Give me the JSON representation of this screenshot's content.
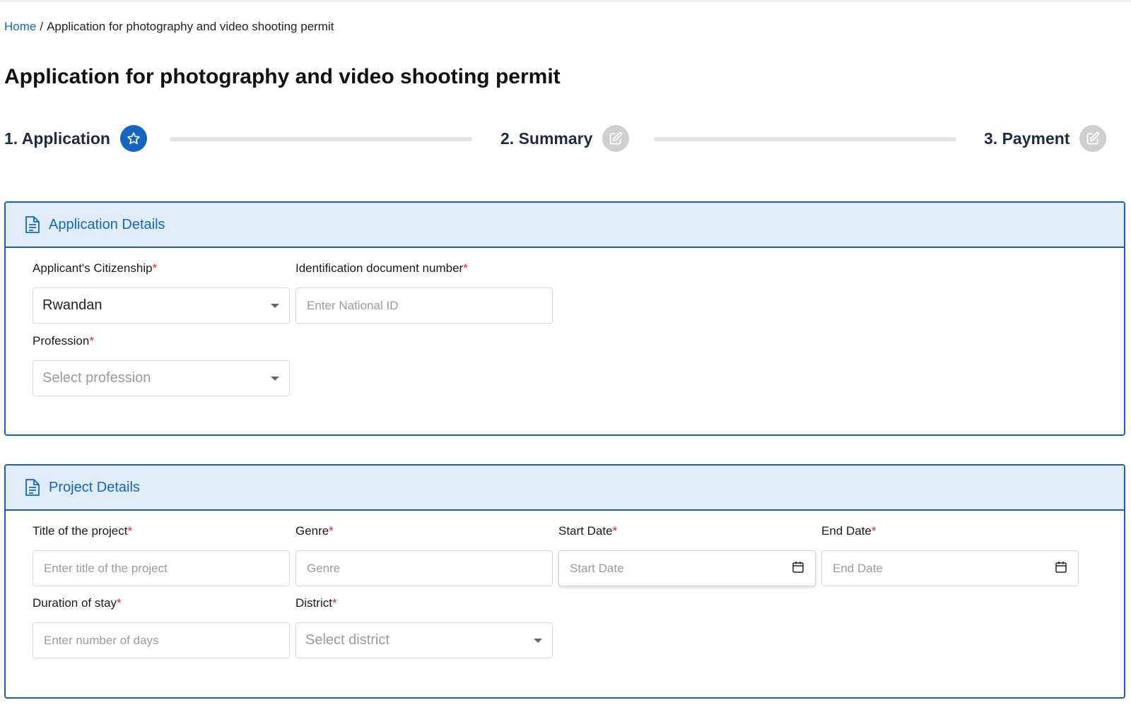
{
  "breadcrumb": {
    "home": "Home",
    "separator": "/",
    "current": "Application for photography and video shooting permit"
  },
  "page": {
    "title": "Application for photography and video shooting permit"
  },
  "steps": [
    {
      "label": "1. Application",
      "icon": "star-icon",
      "state": "active"
    },
    {
      "label": "2. Summary",
      "icon": "edit-icon",
      "state": "inactive"
    },
    {
      "label": "3. Payment",
      "icon": "edit-icon",
      "state": "inactive"
    }
  ],
  "application_details": {
    "title": "Application Details",
    "icon": "document-icon",
    "citizenship": {
      "label": "Applicant's Citizenship",
      "required": "*",
      "value": "Rwandan"
    },
    "id_number": {
      "label": "Identification document number",
      "required": "*",
      "placeholder": "Enter National ID"
    },
    "profession": {
      "label": "Profession",
      "required": "*",
      "placeholder": "Select profession"
    }
  },
  "project_details": {
    "title": "Project Details",
    "icon": "document-icon",
    "project_title": {
      "label": "Title of the project",
      "required": "*",
      "placeholder": "Enter title of the project"
    },
    "genre": {
      "label": "Genre",
      "required": "*",
      "placeholder": "Genre"
    },
    "start_date": {
      "label": "Start Date",
      "required": "*",
      "placeholder": "Start Date"
    },
    "end_date": {
      "label": "End Date",
      "required": "*",
      "placeholder": "End Date"
    },
    "duration": {
      "label": "Duration of stay",
      "required": "*",
      "placeholder": "Enter number of days"
    },
    "district": {
      "label": "District",
      "required": "*",
      "placeholder": "Select district"
    }
  },
  "colors": {
    "accent": "#1565c0",
    "card_border": "#1f5cc0",
    "card_header_bg": "#e0edf8",
    "required": "#e02424",
    "inactive_step": "#cfcfcf"
  }
}
